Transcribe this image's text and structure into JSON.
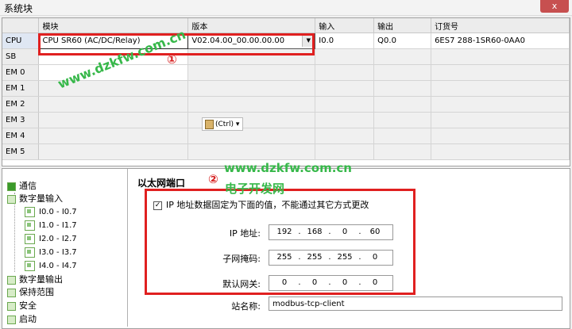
{
  "window": {
    "title": "系统块",
    "close_label": "x"
  },
  "grid": {
    "headers": [
      "",
      "模块",
      "版本",
      "输入",
      "输出",
      "订货号"
    ],
    "rows": [
      {
        "label": "CPU",
        "module": "CPU SR60 (AC/DC/Relay)",
        "version": "V02.04.00_00.00.00.00",
        "input": "I0.0",
        "output": "Q0.0",
        "order": "6ES7 288-1SR60-0AA0"
      },
      {
        "label": "SB",
        "module": "",
        "version": "",
        "input": "",
        "output": "",
        "order": ""
      },
      {
        "label": "EM 0",
        "module": "",
        "version": "",
        "input": "",
        "output": "",
        "order": ""
      },
      {
        "label": "EM 1",
        "module": "",
        "version": "",
        "input": "",
        "output": "",
        "order": ""
      },
      {
        "label": "EM 2",
        "module": "",
        "version": "",
        "input": "",
        "output": "",
        "order": ""
      },
      {
        "label": "EM 3",
        "module": "",
        "version": "",
        "input": "",
        "output": "",
        "order": ""
      },
      {
        "label": "EM 4",
        "module": "",
        "version": "",
        "input": "",
        "output": "",
        "order": ""
      },
      {
        "label": "EM 5",
        "module": "",
        "version": "",
        "input": "",
        "output": "",
        "order": ""
      }
    ],
    "paste_tag": "(Ctrl)"
  },
  "annotations": {
    "mark1": "①",
    "mark2": "②"
  },
  "watermarks": {
    "top": "www.dzkfw.com.cn",
    "mid": "www.dzkfw.com.cn",
    "mid_cn": "电子开发网"
  },
  "tree": {
    "items": [
      "通信",
      "数字量输入",
      "数字量输出",
      "保持范围",
      "安全",
      "启动"
    ],
    "digital_inputs": [
      "I0.0 - I0.7",
      "I1.0 - I1.7",
      "I2.0 - I2.7",
      "I3.0 - I3.7",
      "I4.0 - I4.7"
    ]
  },
  "ethernet": {
    "section_title": "以太网端口",
    "fixed_ip_label": "IP 地址数据固定为下面的值，不能通过其它方式更改",
    "fixed_ip_checked": true,
    "ip_label": "IP 地址:",
    "ip": [
      "192",
      "168",
      "0",
      "60"
    ],
    "mask_label": "子网掩码:",
    "mask": [
      "255",
      "255",
      "255",
      "0"
    ],
    "gateway_label": "默认网关:",
    "gateway": [
      "0",
      "0",
      "0",
      "0"
    ],
    "station_label": "站名称:",
    "station_name": "modbus-tcp-client",
    "dot": "."
  },
  "colors": {
    "annotation_red": "#e02020",
    "watermark_green": "#37b84a"
  }
}
